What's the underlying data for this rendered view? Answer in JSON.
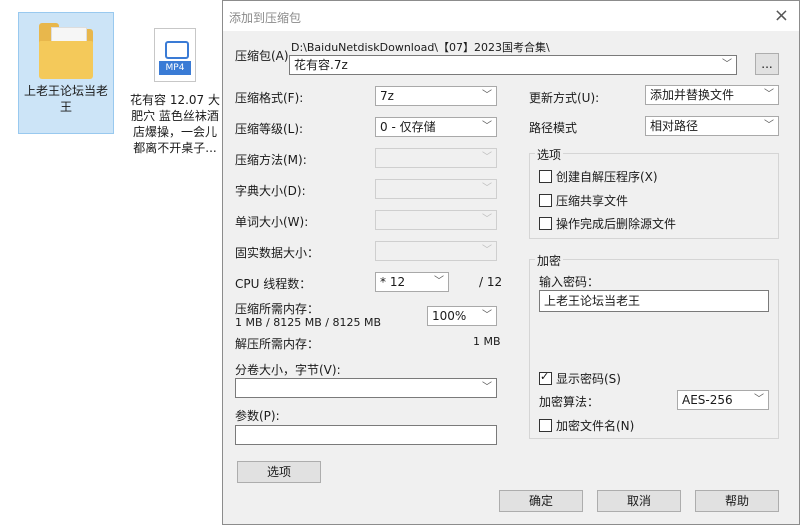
{
  "desktop": {
    "folder_label": "上老王论坛当老王",
    "video_badge": "MP4",
    "video_label": "花有容 12.07 大肥穴 蓝色丝袜酒店爆操，一会儿都离不开桌子..."
  },
  "dialog": {
    "title": "添加到压缩包",
    "close_label": "×",
    "archive_label": "压缩包(A)",
    "archive_path": "D:\\BaiduNetdiskDownload\\【07】2023国考合集\\",
    "archive_name": "花有容.7z",
    "browse_label": "...",
    "format_label": "压缩格式(F):",
    "format_value": "7z",
    "level_label": "压缩等级(L):",
    "level_value": "0 - 仅存储",
    "method_label": "压缩方法(M):",
    "dict_label": "字典大小(D):",
    "word_label": "单词大小(W):",
    "solid_label": "固实数据大小：",
    "threads_label": "CPU 线程数：",
    "threads_value": "* 12",
    "threads_total": "/ 12",
    "mem_compress_label": "压缩所需内存：",
    "mem_compress_value": "1 MB / 8125 MB / 8125 MB",
    "mem_percent": "100%",
    "mem_decompress_label": "解压所需内存：",
    "mem_decompress_value": "1 MB",
    "split_label": "分卷大小，字节(V):",
    "params_label": "参数(P):",
    "options_button": "选项",
    "update_label": "更新方式(U):",
    "update_value": "添加并替换文件",
    "path_label": "路径模式",
    "path_value": "相对路径",
    "options_group": "选项",
    "opt_sfx": "创建自解压程序(X)",
    "opt_shared": "压缩共享文件",
    "opt_delete": "操作完成后删除源文件",
    "encrypt_group": "加密",
    "password_label": "输入密码：",
    "password_value": "上老王论坛当老王",
    "show_password": "显示密码(S)",
    "algo_label": "加密算法：",
    "algo_value": "AES-256",
    "encrypt_names": "加密文件名(N)",
    "ok_button": "确定",
    "cancel_button": "取消",
    "help_button": "帮助"
  }
}
